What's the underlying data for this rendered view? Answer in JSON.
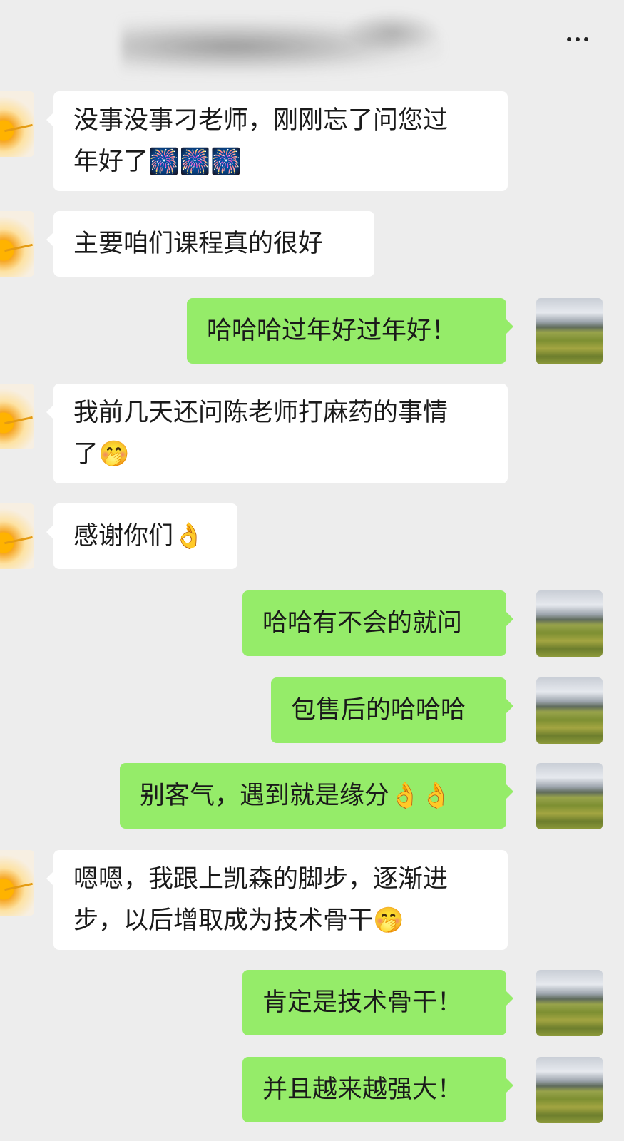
{
  "header": {
    "more_label": "•••"
  },
  "messages": [
    {
      "side": "left",
      "text": "没事没事刁老师，刚刚忘了问您过\n年好了🎆🎆🎆"
    },
    {
      "side": "left",
      "text": "主要咱们课程真的很好"
    },
    {
      "side": "right",
      "text": "哈哈哈过年好过年好！"
    },
    {
      "side": "left",
      "text": "我前几天还问陈老师打麻药的事情\n了🤭"
    },
    {
      "side": "left",
      "text": "感谢你们👌"
    },
    {
      "side": "right",
      "text": "哈哈有不会的就问"
    },
    {
      "side": "right",
      "text": "包售后的哈哈哈"
    },
    {
      "side": "right",
      "text": "别客气，遇到就是缘分👌👌"
    },
    {
      "side": "left",
      "text": "嗯嗯，我跟上凯森的脚步，逐渐进\n步，以后增取成为技术骨干🤭"
    },
    {
      "side": "right",
      "text": "肯定是技术骨干！"
    },
    {
      "side": "right",
      "text": "并且越来越强大！"
    }
  ],
  "colors": {
    "background": "#ededed",
    "bubble_in": "#ffffff",
    "bubble_out": "#95ec69"
  }
}
